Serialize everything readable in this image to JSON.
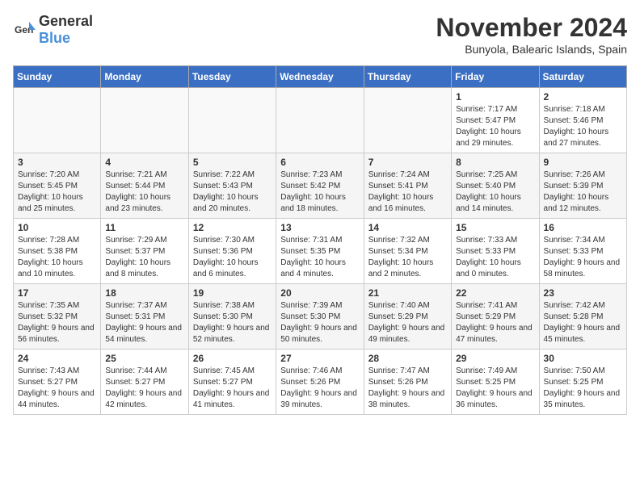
{
  "logo": {
    "text_general": "General",
    "text_blue": "Blue"
  },
  "title": "November 2024",
  "location": "Bunyola, Balearic Islands, Spain",
  "days_of_week": [
    "Sunday",
    "Monday",
    "Tuesday",
    "Wednesday",
    "Thursday",
    "Friday",
    "Saturday"
  ],
  "weeks": [
    [
      {
        "day": "",
        "info": ""
      },
      {
        "day": "",
        "info": ""
      },
      {
        "day": "",
        "info": ""
      },
      {
        "day": "",
        "info": ""
      },
      {
        "day": "",
        "info": ""
      },
      {
        "day": "1",
        "info": "Sunrise: 7:17 AM\nSunset: 5:47 PM\nDaylight: 10 hours and 29 minutes."
      },
      {
        "day": "2",
        "info": "Sunrise: 7:18 AM\nSunset: 5:46 PM\nDaylight: 10 hours and 27 minutes."
      }
    ],
    [
      {
        "day": "3",
        "info": "Sunrise: 7:20 AM\nSunset: 5:45 PM\nDaylight: 10 hours and 25 minutes."
      },
      {
        "day": "4",
        "info": "Sunrise: 7:21 AM\nSunset: 5:44 PM\nDaylight: 10 hours and 23 minutes."
      },
      {
        "day": "5",
        "info": "Sunrise: 7:22 AM\nSunset: 5:43 PM\nDaylight: 10 hours and 20 minutes."
      },
      {
        "day": "6",
        "info": "Sunrise: 7:23 AM\nSunset: 5:42 PM\nDaylight: 10 hours and 18 minutes."
      },
      {
        "day": "7",
        "info": "Sunrise: 7:24 AM\nSunset: 5:41 PM\nDaylight: 10 hours and 16 minutes."
      },
      {
        "day": "8",
        "info": "Sunrise: 7:25 AM\nSunset: 5:40 PM\nDaylight: 10 hours and 14 minutes."
      },
      {
        "day": "9",
        "info": "Sunrise: 7:26 AM\nSunset: 5:39 PM\nDaylight: 10 hours and 12 minutes."
      }
    ],
    [
      {
        "day": "10",
        "info": "Sunrise: 7:28 AM\nSunset: 5:38 PM\nDaylight: 10 hours and 10 minutes."
      },
      {
        "day": "11",
        "info": "Sunrise: 7:29 AM\nSunset: 5:37 PM\nDaylight: 10 hours and 8 minutes."
      },
      {
        "day": "12",
        "info": "Sunrise: 7:30 AM\nSunset: 5:36 PM\nDaylight: 10 hours and 6 minutes."
      },
      {
        "day": "13",
        "info": "Sunrise: 7:31 AM\nSunset: 5:35 PM\nDaylight: 10 hours and 4 minutes."
      },
      {
        "day": "14",
        "info": "Sunrise: 7:32 AM\nSunset: 5:34 PM\nDaylight: 10 hours and 2 minutes."
      },
      {
        "day": "15",
        "info": "Sunrise: 7:33 AM\nSunset: 5:33 PM\nDaylight: 10 hours and 0 minutes."
      },
      {
        "day": "16",
        "info": "Sunrise: 7:34 AM\nSunset: 5:33 PM\nDaylight: 9 hours and 58 minutes."
      }
    ],
    [
      {
        "day": "17",
        "info": "Sunrise: 7:35 AM\nSunset: 5:32 PM\nDaylight: 9 hours and 56 minutes."
      },
      {
        "day": "18",
        "info": "Sunrise: 7:37 AM\nSunset: 5:31 PM\nDaylight: 9 hours and 54 minutes."
      },
      {
        "day": "19",
        "info": "Sunrise: 7:38 AM\nSunset: 5:30 PM\nDaylight: 9 hours and 52 minutes."
      },
      {
        "day": "20",
        "info": "Sunrise: 7:39 AM\nSunset: 5:30 PM\nDaylight: 9 hours and 50 minutes."
      },
      {
        "day": "21",
        "info": "Sunrise: 7:40 AM\nSunset: 5:29 PM\nDaylight: 9 hours and 49 minutes."
      },
      {
        "day": "22",
        "info": "Sunrise: 7:41 AM\nSunset: 5:29 PM\nDaylight: 9 hours and 47 minutes."
      },
      {
        "day": "23",
        "info": "Sunrise: 7:42 AM\nSunset: 5:28 PM\nDaylight: 9 hours and 45 minutes."
      }
    ],
    [
      {
        "day": "24",
        "info": "Sunrise: 7:43 AM\nSunset: 5:27 PM\nDaylight: 9 hours and 44 minutes."
      },
      {
        "day": "25",
        "info": "Sunrise: 7:44 AM\nSunset: 5:27 PM\nDaylight: 9 hours and 42 minutes."
      },
      {
        "day": "26",
        "info": "Sunrise: 7:45 AM\nSunset: 5:27 PM\nDaylight: 9 hours and 41 minutes."
      },
      {
        "day": "27",
        "info": "Sunrise: 7:46 AM\nSunset: 5:26 PM\nDaylight: 9 hours and 39 minutes."
      },
      {
        "day": "28",
        "info": "Sunrise: 7:47 AM\nSunset: 5:26 PM\nDaylight: 9 hours and 38 minutes."
      },
      {
        "day": "29",
        "info": "Sunrise: 7:49 AM\nSunset: 5:25 PM\nDaylight: 9 hours and 36 minutes."
      },
      {
        "day": "30",
        "info": "Sunrise: 7:50 AM\nSunset: 5:25 PM\nDaylight: 9 hours and 35 minutes."
      }
    ]
  ]
}
